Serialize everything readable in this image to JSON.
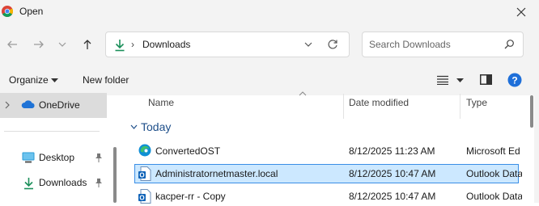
{
  "window": {
    "title": "Open"
  },
  "address": {
    "location": "Downloads",
    "separator": "›"
  },
  "search": {
    "placeholder": "Search Downloads"
  },
  "commands": {
    "organize": "Organize",
    "new_folder": "New folder"
  },
  "nav": {
    "items": [
      {
        "label": "OneDrive",
        "icon": "cloud-icon",
        "selected": true
      },
      {
        "label": "Desktop",
        "icon": "desktop-icon",
        "pinned": true
      },
      {
        "label": "Downloads",
        "icon": "download-arrow-icon",
        "pinned": true
      }
    ]
  },
  "columns": {
    "name": "Name",
    "date": "Date modified",
    "type": "Type"
  },
  "group": {
    "label": "Today"
  },
  "files": [
    {
      "name": "ConvertedOST",
      "date": "8/12/2025 11:23 AM",
      "type": "Microsoft Ed",
      "icon": "edge-icon",
      "selected": false
    },
    {
      "name": "Administratornetmaster.local",
      "date": "8/12/2025 10:47 AM",
      "type": "Outlook Data",
      "icon": "outlook-data-file-icon",
      "selected": true
    },
    {
      "name": "kacper-rr - Copy",
      "date": "8/12/2025 10:47 AM",
      "type": "Outlook Data",
      "icon": "outlook-data-file-icon",
      "selected": false
    }
  ],
  "colors": {
    "accent": "#0067c0",
    "selection": "#cce8ff",
    "selection_border": "#3a8ee6",
    "chrome": "#f3f3f3"
  }
}
